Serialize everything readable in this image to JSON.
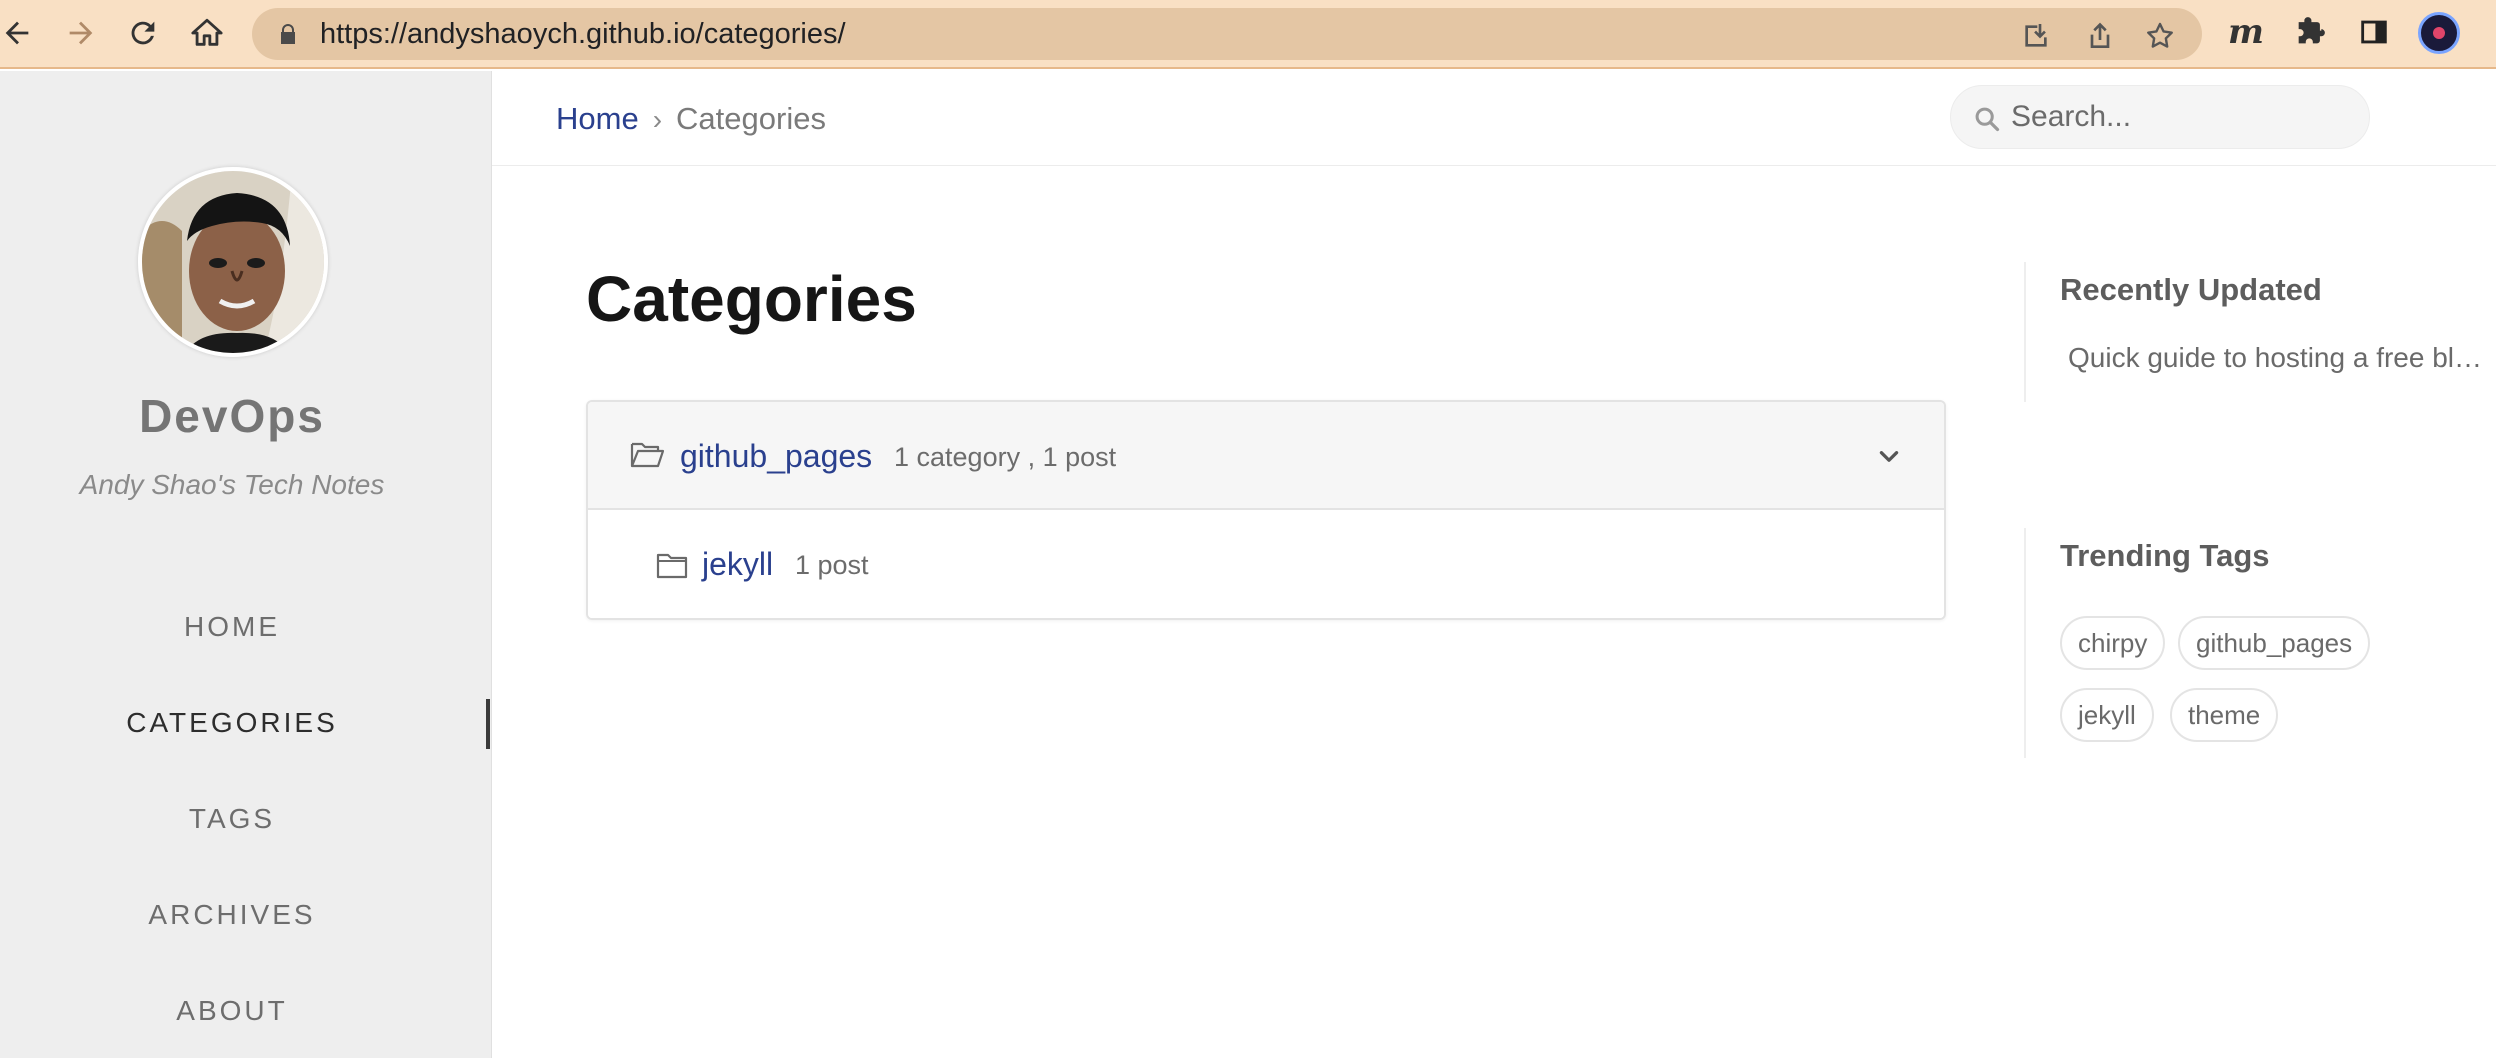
{
  "browser": {
    "url_host": "https://andyshaoych.github.io",
    "url_path": "/categories/",
    "extension_label": "m"
  },
  "sidebar": {
    "site_title": "DevOps",
    "site_subtitle": "Andy Shao's Tech Notes",
    "nav": [
      {
        "label": "HOME",
        "active": false
      },
      {
        "label": "CATEGORIES",
        "active": true
      },
      {
        "label": "TAGS",
        "active": false
      },
      {
        "label": "ARCHIVES",
        "active": false
      },
      {
        "label": "ABOUT",
        "active": false
      }
    ]
  },
  "topbar": {
    "breadcrumb": {
      "home": "Home",
      "separator": "›",
      "current": "Categories"
    },
    "search_placeholder": "Search..."
  },
  "main": {
    "title": "Categories",
    "categories": [
      {
        "name": "github_pages",
        "meta": "1 category , 1 post",
        "expanded": true,
        "children": [
          {
            "name": "jekyll",
            "meta": "1 post"
          }
        ]
      }
    ]
  },
  "panels": {
    "recently_updated": {
      "title": "Recently Updated",
      "items": [
        "Quick guide to hosting a free blog on GitHub Pages"
      ]
    },
    "trending_tags": {
      "title": "Trending Tags",
      "tags": [
        "chirpy",
        "github_pages",
        "jekyll",
        "theme"
      ]
    }
  },
  "colors": {
    "browser_bar": "#f9e0c4",
    "link": "#2a408e",
    "sidebar_bg": "#eeeeee"
  }
}
